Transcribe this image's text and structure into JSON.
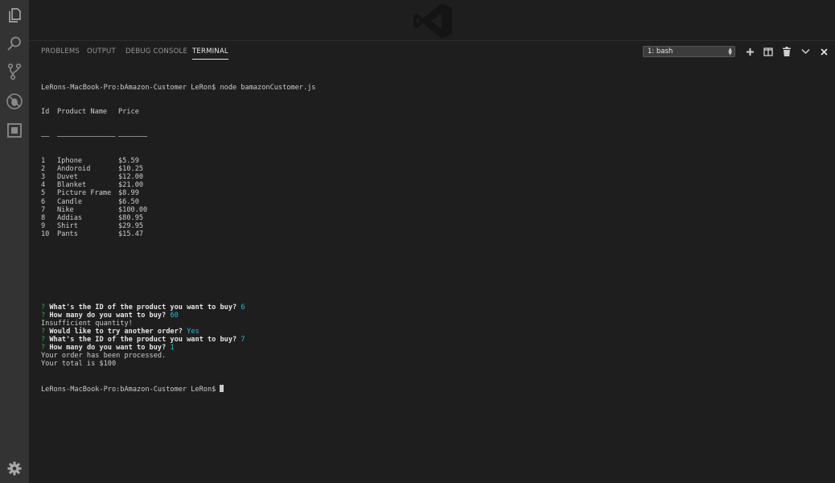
{
  "panel": {
    "tabs": [
      {
        "label": "PROBLEMS"
      },
      {
        "label": "OUTPUT"
      },
      {
        "label": "DEBUG CONSOLE"
      },
      {
        "label": "TERMINAL"
      }
    ],
    "active_tab": "TERMINAL",
    "terminal_select": "1: bash"
  },
  "terminal": {
    "command_line": "LeRons-MacBook-Pro:bAmazon-Customer LeRon$ node bamazonCustomer.js",
    "header": {
      "id": "Id",
      "name": "Product Name",
      "price": "Price"
    },
    "underline": {
      "id": "——",
      "name": "——————————————",
      "price": "———————"
    },
    "products": [
      {
        "id": "1",
        "name": "Iphone",
        "price": "$5.59"
      },
      {
        "id": "2",
        "name": "Andoroid",
        "price": "$10.25"
      },
      {
        "id": "3",
        "name": "Duvet",
        "price": "$12.00"
      },
      {
        "id": "4",
        "name": "Blanket",
        "price": "$21.00"
      },
      {
        "id": "5",
        "name": "Picture Frame",
        "price": "$8.99"
      },
      {
        "id": "6",
        "name": "Candle",
        "price": "$6.50"
      },
      {
        "id": "7",
        "name": "Nike",
        "price": "$100.00"
      },
      {
        "id": "8",
        "name": "Addias",
        "price": "$80.95"
      },
      {
        "id": "9",
        "name": "Shirt",
        "price": "$29.95"
      },
      {
        "id": "10",
        "name": "Pants",
        "price": "$15.47"
      }
    ],
    "session": [
      {
        "q": "?",
        "prompt": "What's the ID of the product you want to buy?",
        "answer": "6"
      },
      {
        "q": "?",
        "prompt": "How many do you want to buy?",
        "answer": "60"
      },
      {
        "text": "Insufficient quantity!"
      },
      {
        "q": "?",
        "prompt": "Would like to try another order?",
        "answer": "Yes"
      },
      {
        "q": "?",
        "prompt": "What's the ID of the product you want to buy?",
        "answer": "7"
      },
      {
        "q": "?",
        "prompt": "How many do you want to buy?",
        "answer": "1"
      },
      {
        "text": "Your order has been processed."
      },
      {
        "text": "Your total is $100"
      }
    ],
    "final_prompt": "LeRons-MacBook-Pro:bAmazon-Customer LeRon$ "
  },
  "colors": {
    "background": "#1e1e1e",
    "activity_bar": "#333333",
    "prompt_mark": "#3aa33a",
    "answer": "#29b8db"
  },
  "icons": [
    "explorer-icon",
    "search-icon",
    "source-control-icon",
    "debug-icon",
    "extensions-icon",
    "settings-gear-icon",
    "new-terminal-icon",
    "split-terminal-icon",
    "trash-icon",
    "chevron-down-icon",
    "close-icon",
    "vscode-logo"
  ]
}
